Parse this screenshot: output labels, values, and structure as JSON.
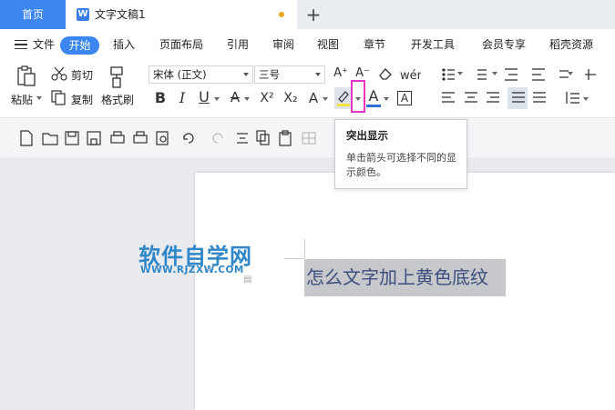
{
  "titlebar": {
    "home_tab": "首页",
    "doc_tab": "文字文稿1",
    "doc_icon": "W",
    "new_tab_icon": "+"
  },
  "menu": {
    "file": "文件",
    "items": [
      "开始",
      "插入",
      "页面布局",
      "引用",
      "审阅",
      "视图",
      "章节",
      "开发工具",
      "会员专享",
      "稻壳资源"
    ]
  },
  "ribbon": {
    "paste": "粘贴",
    "cut": "剪切",
    "copy": "复制",
    "format_painter": "格式刷",
    "font_name": "宋体 (正文)",
    "font_size": "三号",
    "bold": "B",
    "italic": "I",
    "underline": "U",
    "strikethrough": "A",
    "superscript": "X²",
    "subscript": "X₂",
    "font_effects": "A",
    "font_color": "A",
    "char_border": "A",
    "grow_font": "A⁺",
    "shrink_font": "A⁻"
  },
  "tooltip": {
    "title": "突出显示",
    "body": "单击箭头可选择不同的显示颜色。"
  },
  "document": {
    "watermark_main": "软件自学网",
    "watermark_sub": "WWW.RJZXW.COM",
    "selected_text": "怎么文字加上黄色底纹"
  },
  "colors": {
    "accent": "#3b86f0",
    "highlight_box": "#e934c9",
    "selection_bg": "#c7c8cb",
    "logo": "#2f86c9"
  }
}
